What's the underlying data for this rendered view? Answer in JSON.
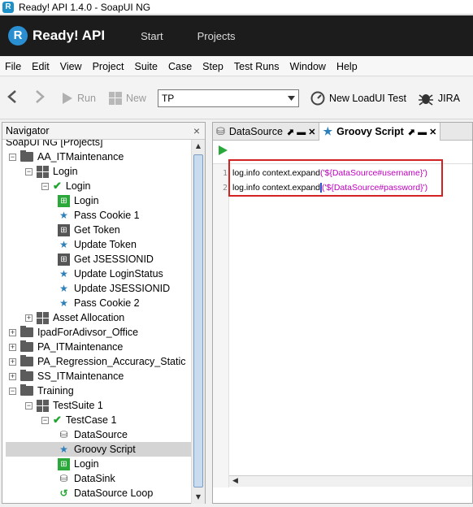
{
  "window": {
    "title": "Ready! API 1.4.0 - SoapUI NG",
    "app_icon": "R"
  },
  "brand": {
    "logo": "R",
    "name": "Ready! API",
    "nav": [
      "Start",
      "Projects"
    ]
  },
  "menu": [
    "File",
    "Edit",
    "View",
    "Project",
    "Suite",
    "Case",
    "Step",
    "Test Runs",
    "Window",
    "Help"
  ],
  "toolbar": {
    "run_label": "Run",
    "new_label": "New",
    "select_value": "TP",
    "new_loadui_label": "New LoadUI Test",
    "jira_label": "JIRA"
  },
  "navigator": {
    "title": "Navigator",
    "close": "×",
    "tree": [
      {
        "label": "SoapUI NG [Projects]",
        "icon": "none"
      },
      {
        "label": "AA_ITMaintenance",
        "icon": "folder-icon",
        "exp": "−"
      },
      {
        "label": "Login",
        "icon": "testsuite-icon",
        "exp": "−"
      },
      {
        "label": "Login",
        "icon": "check-icon",
        "exp": "−"
      },
      {
        "label": "Login",
        "icon": "login-step-icon"
      },
      {
        "label": "Pass Cookie 1",
        "icon": "star-icon"
      },
      {
        "label": "Get Token",
        "icon": "request-icon"
      },
      {
        "label": "Update Token",
        "icon": "star-icon"
      },
      {
        "label": "Get JSESSIONID",
        "icon": "request-icon"
      },
      {
        "label": "Update LoginStatus",
        "icon": "star-icon"
      },
      {
        "label": "Update JSESSIONID",
        "icon": "star-icon"
      },
      {
        "label": "Pass Cookie 2",
        "icon": "star-icon"
      },
      {
        "label": "Asset Allocation",
        "icon": "testsuite-icon",
        "exp": "+"
      },
      {
        "label": "IpadForAdivsor_Office",
        "icon": "folder-icon",
        "exp": "+"
      },
      {
        "label": "PA_ITMaintenance",
        "icon": "folder-icon",
        "exp": "+"
      },
      {
        "label": "PA_Regression_Accuracy_Static",
        "icon": "folder-icon",
        "exp": "+"
      },
      {
        "label": "SS_ITMaintenance",
        "icon": "folder-icon",
        "exp": "+"
      },
      {
        "label": "Training",
        "icon": "folder-icon",
        "exp": "−"
      },
      {
        "label": "TestSuite 1",
        "icon": "testsuite-icon",
        "exp": "−"
      },
      {
        "label": "TestCase 1",
        "icon": "check-icon",
        "exp": "−"
      },
      {
        "label": "DataSource",
        "icon": "datasource-icon"
      },
      {
        "label": "Groovy Script",
        "icon": "star-icon"
      },
      {
        "label": "Login",
        "icon": "login-step-icon"
      },
      {
        "label": "DataSink",
        "icon": "datasink-icon"
      },
      {
        "label": "DataSource Loop",
        "icon": "loop-icon"
      }
    ]
  },
  "editor": {
    "tabs": [
      {
        "label": "DataSource",
        "icon": "datasource-icon"
      },
      {
        "label": "Groovy Script",
        "icon": "star-icon"
      }
    ],
    "tab_controls": "⬈ ▬ ✕",
    "lines": [
      {
        "num": "1",
        "prefix": "log.info context.expand",
        "arg": "('${DataSource#username}')"
      },
      {
        "num": "2",
        "prefix": "log.info context.expand",
        "arg": "('${DataSource#password}')"
      }
    ]
  }
}
